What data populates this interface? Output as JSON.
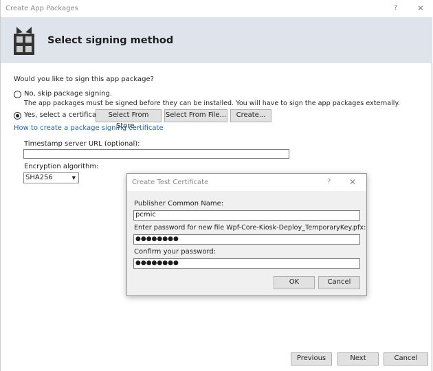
{
  "window": {
    "title": "Create App Packages",
    "help": "?",
    "close": "✕"
  },
  "header": {
    "title": "Select signing method",
    "icon": "gift-package-icon"
  },
  "main": {
    "question": "Would you like to sign this app package?",
    "option_no": "No, skip package signing.",
    "option_no_note": "The app packages must be signed before they can be installed. You will have to sign the app packages externally.",
    "option_yes": "Yes, select a certificate:",
    "selected_option": "yes",
    "select_from_store": "Select From Store...",
    "select_from_file": "Select From File...",
    "create": "Create...",
    "link": "How to create a package signing certificate",
    "timestamp_label": "Timestamp server URL (optional):",
    "timestamp_value": "",
    "encryption_label": "Encryption algorithm:",
    "encryption_value": "SHA256"
  },
  "dialog": {
    "title": "Create Test Certificate",
    "help": "?",
    "close": "✕",
    "publisher_label": "Publisher Common Name:",
    "publisher_value": "pcmic",
    "password_label": "Enter password for new file Wpf-Core-Kiosk-Deploy_TemporaryKey.pfx:",
    "password_value": "●●●●●●●●",
    "confirm_label": "Confirm your password:",
    "confirm_value": "●●●●●●●●",
    "ok": "OK",
    "cancel": "Cancel"
  },
  "footer": {
    "previous": "Previous",
    "next": "Next",
    "cancel": "Cancel"
  }
}
